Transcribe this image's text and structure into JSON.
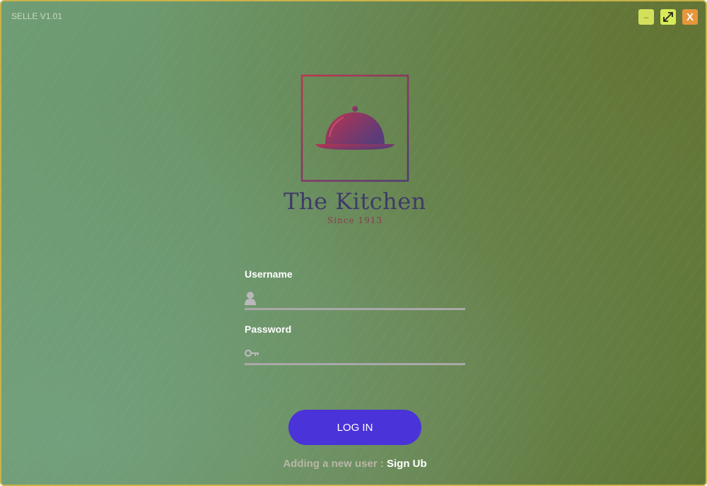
{
  "window": {
    "title": "SELLE V1.01",
    "controls": {
      "minimize_label": "–",
      "maximize_icon": "expand-arrows-icon",
      "close_label": "X"
    }
  },
  "brand": {
    "name": "The Kitchen",
    "since": "Since 1913",
    "logo_icon": "cloche-icon"
  },
  "form": {
    "username": {
      "label": "Username",
      "value": "",
      "placeholder": "",
      "icon": "user-icon"
    },
    "password": {
      "label": "Password",
      "value": "",
      "placeholder": "",
      "icon": "key-icon"
    },
    "login_label": "LOG IN",
    "signup_prefix": "Adding a new user : ",
    "signup_link": "Sign Ub"
  },
  "colors": {
    "accent": "#4a33d8",
    "logo_red": "#b8344f",
    "logo_purple": "#4f3a78",
    "minimize": "#d3e05c",
    "maximize": "#d8ea57",
    "close": "#e6963c"
  }
}
